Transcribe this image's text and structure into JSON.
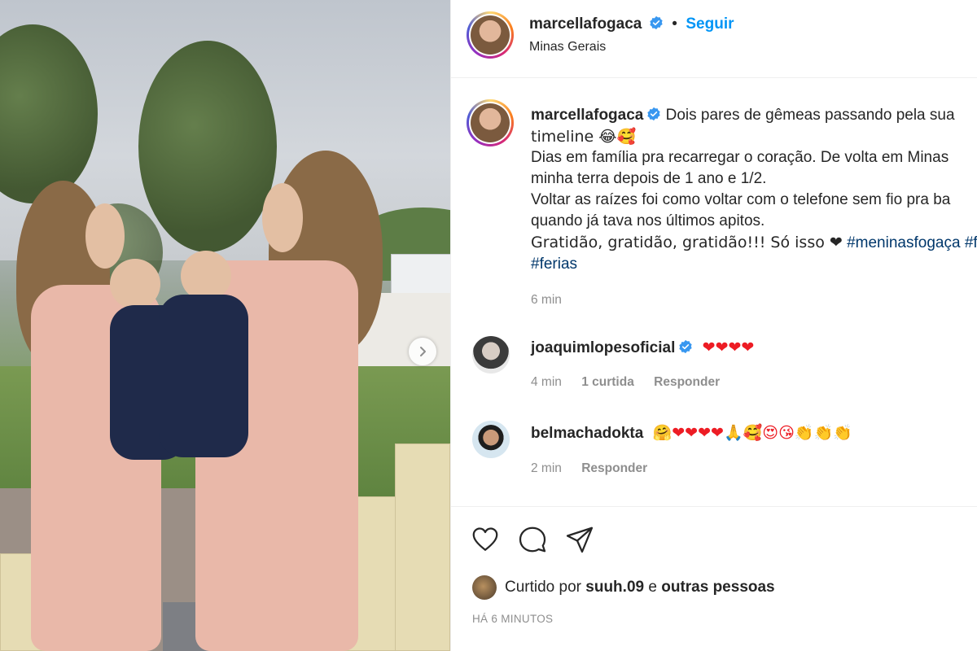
{
  "post": {
    "author": "marcellafogaca",
    "location": "Minas Gerais",
    "follow_label": "Seguir",
    "dot": "•"
  },
  "caption": {
    "author": "marcellafogaca",
    "line1": "Dois pares de gêmeas passando pela sua",
    "line2": "timeline 😂🥰",
    "line3": "Dias em família pra recarregar o coração. De volta em Minas",
    "line4": "minha terra depois de 1 ano e 1/2.",
    "line5": "Voltar as raízes foi como voltar com o telefone sem fio pra ba",
    "line6": "quando já tava nos últimos apitos.",
    "line7": "Gratidão, gratidão, gratidão!!! Só isso ❤",
    "hashtag1": "#meninasfogaça",
    "hashtag2": "#f",
    "hashtag3": "#ferias",
    "time": "6 min"
  },
  "comments": [
    {
      "author": "joaquimlopesoficial",
      "text": "❤❤❤❤",
      "time": "4 min",
      "likes": "1 curtida",
      "reply": "Responder"
    },
    {
      "author": "belmachadokta",
      "text": "🤗❤❤❤❤🙏🥰😍😘👏👏👏",
      "time": "2 min",
      "reply": "Responder"
    }
  ],
  "footer": {
    "liked_prefix": "Curtido por",
    "liked_user": "suuh.09",
    "liked_and": "e",
    "liked_others": "outras pessoas",
    "timestamp": "HÁ 6 MINUTOS"
  },
  "icons": {
    "like": "heart-outline-icon",
    "comment": "comment-bubble-icon",
    "share": "paper-plane-icon",
    "verified": "verified-badge-icon",
    "next": "chevron-right-icon"
  },
  "colors": {
    "link_blue": "#0095f6",
    "hashtag": "#00376b",
    "muted": "#8e8e8e",
    "text": "#262626"
  }
}
